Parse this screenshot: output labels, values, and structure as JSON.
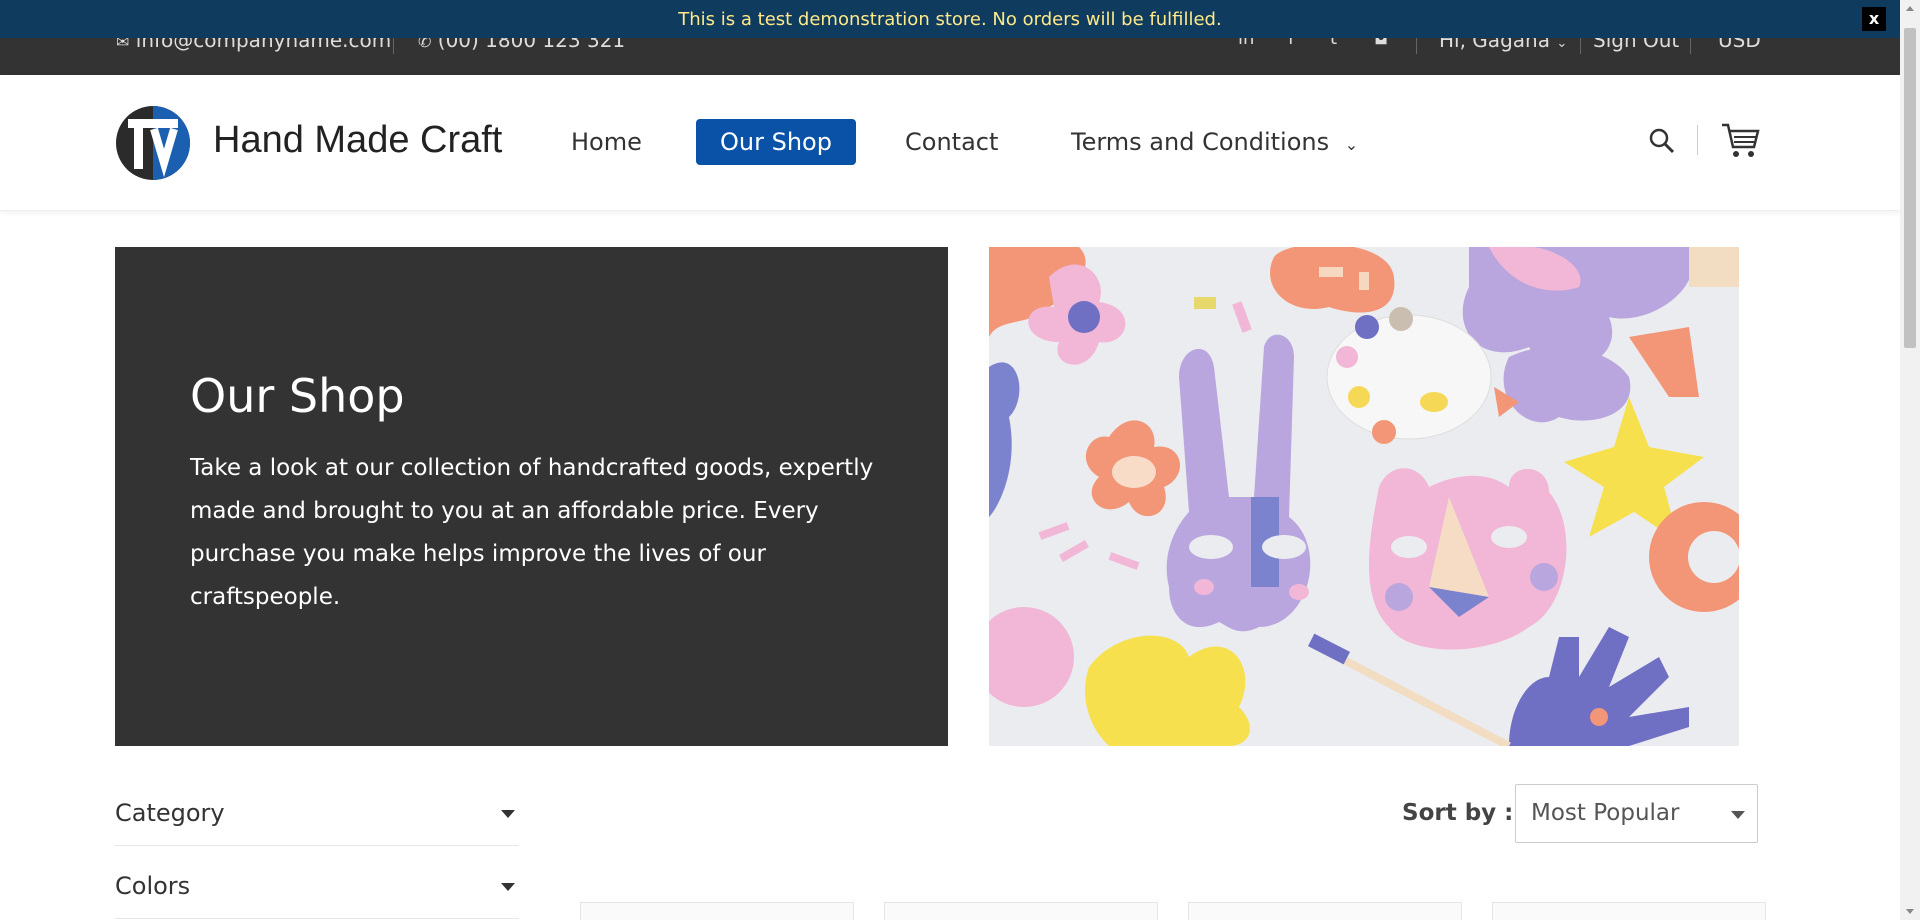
{
  "banner": {
    "message": "This is a test demonstration store. No orders will be fulfilled.",
    "close_label": "x"
  },
  "topbar": {
    "email": "info@companyname.com",
    "phone": "(00) 1800 123 321",
    "user_greeting": "Hi, Gagana",
    "sign_out": "Sign Out",
    "currency": "USD",
    "social_icons": [
      "linkedin-icon",
      "facebook-icon",
      "twitter-icon",
      "instagram-icon"
    ]
  },
  "header": {
    "brand_name": "Hand Made Craft",
    "nav": [
      {
        "label": "Home",
        "active": false
      },
      {
        "label": "Our Shop",
        "active": true
      },
      {
        "label": "Contact",
        "active": false
      },
      {
        "label": "Terms and Conditions",
        "active": false,
        "has_dropdown": true
      }
    ],
    "icons": [
      "search-icon",
      "cart-icon"
    ]
  },
  "hero": {
    "title": "Our Shop",
    "description": "Take a look at our collection of handcrafted goods, expertly made and brought to you at an affordable price. Every purchase you make helps improve the lives of our craftspeople."
  },
  "filters": [
    {
      "label": "Category"
    },
    {
      "label": "Colors"
    }
  ],
  "sort": {
    "label": "Sort by :",
    "selected": "Most Popular"
  },
  "colors": {
    "topbar_bg": "#333333",
    "banner_bg": "#0f3b5e",
    "banner_text": "#ffe98a",
    "accent": "#0a51a8"
  }
}
